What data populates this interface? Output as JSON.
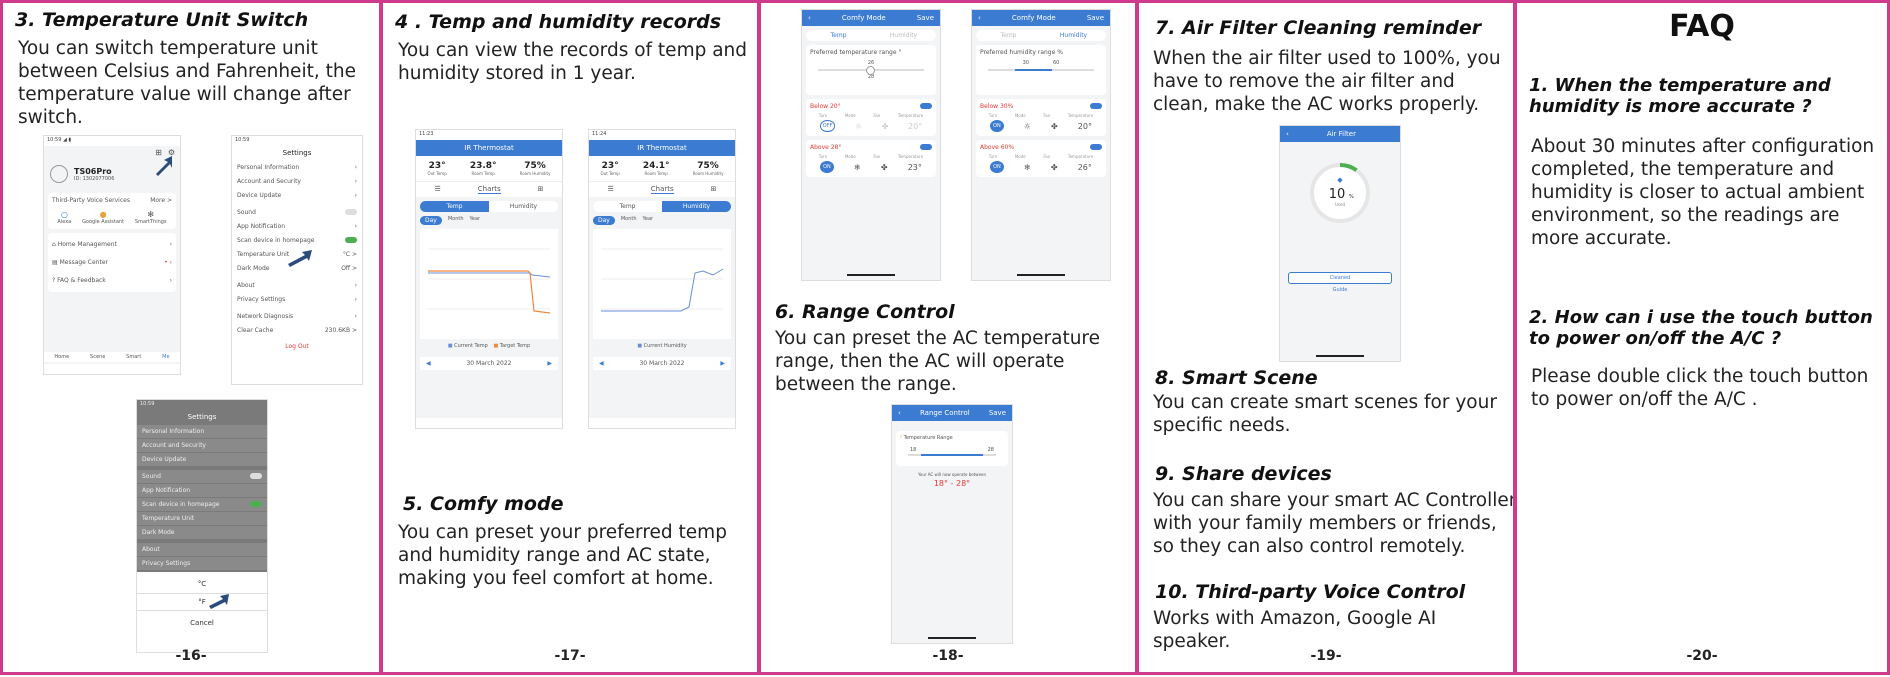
{
  "pages": {
    "p16": {
      "heading": "3. Temperature Unit Switch",
      "body": "You can switch temperature unit between Celsius and Fahrenheit, the temperature value will change after switch.",
      "page_number": "-16-",
      "profile": {
        "name": "TS06Pro",
        "id": "ID: 1302077006"
      },
      "voice_title": "Third-Party Voice Services",
      "voice_more": "More >",
      "voice_items": [
        "Alexa",
        "Google Assistant",
        "SmartThings"
      ],
      "menu": [
        "Home Management",
        "Message Center",
        "FAQ & Feedback"
      ],
      "bottom_tabs": [
        "Home",
        "Scene",
        "Smart",
        "Me"
      ],
      "settings_title": "Settings",
      "settings_rows": [
        "Personal Information",
        "Account and Security",
        "Device Update",
        "Sound",
        "App Notification",
        "Scan device in homepage",
        "Temperature Unit",
        "Dark Mode",
        "About",
        "Privacy Settings",
        "Network Diagnosis",
        "Clear Cache"
      ],
      "temp_unit_value": "°C >",
      "dark_mode_value": "Off >",
      "cache_value": "230.6KB >",
      "logout": "Log Out",
      "picker_options": [
        "°C",
        "°F"
      ],
      "cancel": "Cancel"
    },
    "p17": {
      "heading": "4 . Temp and humidity records",
      "body": "You can view the records of temp and humidity stored in 1 year.",
      "heading2": "5. Comfy mode",
      "body2": "You can preset your preferred temp and humidity range and AC state, making you feel comfort at home.",
      "page_number": "-17-",
      "phone_title": "IR Thermostat",
      "phone_a": {
        "out": "23",
        "room": "23.8",
        "hum": "75"
      },
      "phone_b": {
        "out": "23",
        "room": "24.1",
        "hum": "75"
      },
      "stat_labels": [
        "Out Temp",
        "Room Temp",
        "Room Humidity"
      ],
      "tabs": [
        "Charts"
      ],
      "seg": [
        "Temp",
        "Humidity"
      ],
      "ranges": [
        "Day",
        "Month",
        "Year"
      ],
      "legend_a": [
        "Current Temp",
        "Target Temp"
      ],
      "legend_b": [
        "Current Humidity"
      ],
      "date": "30 March 2022"
    },
    "p18": {
      "heading": "6. Range Control",
      "body": "You can preset the AC temperature range, then the AC will operate between the range.",
      "page_number": "-18-",
      "comfy_title": "Comfy Mode",
      "save": "Save",
      "comfy_tabs": [
        "Temp",
        "Humidity"
      ],
      "pref_temp": "Preferred temperature range °",
      "pref_hum": "Preferred humidity range %",
      "temp_range": [
        "26",
        "28"
      ],
      "hum_range": [
        "30",
        "60"
      ],
      "below_temp": "Below 20°",
      "above_temp": "Above 28°",
      "below_hum": "Below 30%",
      "above_hum": "Above 60%",
      "ctrl_labels": [
        "Turn",
        "Mode",
        "Fan",
        "Temperature"
      ],
      "val_below_temp": "20°",
      "val_above_temp": "23°",
      "val_below_hum": "20°",
      "val_above_hum": "26°",
      "range_title": "Range Control",
      "range_label": "Temperature Range",
      "range_vals": [
        "18",
        "28"
      ],
      "range_note": "Your AC will now operate between",
      "range_result": "18° - 28°"
    },
    "p19": {
      "heading": "7. Air Filter Cleaning reminder",
      "body": "When the air filter used to 100%, you have to remove the air filter and clean, make the AC works properly.",
      "page_number": "-19-",
      "filter_title": "Air Filter",
      "filter_value": "10",
      "filter_unit": "%",
      "filter_used": "Used",
      "cleaned": "Cleaned",
      "guide": "Guide",
      "h8": "8.  Smart Scene",
      "b8": "You can create smart scenes for your specific needs.",
      "h9": "9.  Share devices",
      "b9": "You can share your smart AC Controller with your family members or friends, so they can also control remotely.",
      "h10": "10. Third-party Voice Control",
      "b10": "Works with Amazon, Google AI speaker."
    },
    "p20": {
      "title": "FAQ",
      "q1": "1. When the temperature and humidity is more accurate ?",
      "a1": "About 30 minutes after configuration completed, the temperature and humidity is closer to actual ambient environment, so the readings are more accurate.",
      "q2": "2. How can i use the touch button to power on/off the A/C ?",
      "a2": "Please double click the touch button to power on/off the A/C .",
      "page_number": "-20-"
    }
  },
  "colors": {
    "border": "#d03a8c",
    "accent": "#3b7bd1",
    "toggle_on": "#4caf50",
    "alert": "#e53935",
    "orange": "#f0883a"
  }
}
